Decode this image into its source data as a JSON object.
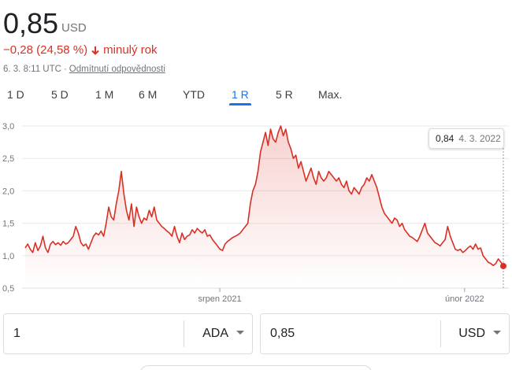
{
  "header": {
    "price": "0,85",
    "currency": "USD",
    "change_text": "−0,28 (24,58 %)",
    "change_period": "minulý rok",
    "timestamp": "6. 3. 8:11 UTC",
    "separator": "·",
    "disclaimer_link": "Odmítnutí odpovědnosti"
  },
  "tabs": [
    {
      "label": "1 D",
      "active": false
    },
    {
      "label": "5 D",
      "active": false
    },
    {
      "label": "1 M",
      "active": false
    },
    {
      "label": "6 M",
      "active": false
    },
    {
      "label": "YTD",
      "active": false
    },
    {
      "label": "1 R",
      "active": true
    },
    {
      "label": "5 R",
      "active": false
    },
    {
      "label": "Max.",
      "active": false
    }
  ],
  "tooltip": {
    "value": "0,84",
    "date": "4. 3. 2022"
  },
  "converter": {
    "from_value": "1",
    "from_unit": "ADA",
    "to_value": "0,85",
    "to_unit": "USD"
  },
  "colors": {
    "line": "#d93025",
    "accent": "#1a73e8",
    "grid": "#e8eaed",
    "axis_text": "#70757a"
  },
  "chart_data": {
    "type": "area",
    "y_ticks": [
      "3,0",
      "2,5",
      "2,0",
      "1,5",
      "1,0",
      "0,5"
    ],
    "y_tick_values": [
      3.0,
      2.5,
      2.0,
      1.5,
      1.0,
      0.5
    ],
    "ylim": [
      0.5,
      3.0
    ],
    "x_ticks": [
      {
        "label": "srpen 2021",
        "t": 0.407
      },
      {
        "label": "únor 2022",
        "t": 0.919
      }
    ],
    "grid": true,
    "series": [
      {
        "values": [
          1.12,
          1.18,
          1.1,
          1.05,
          1.2,
          1.08,
          1.15,
          1.3,
          1.12,
          1.05,
          1.18,
          1.22,
          1.17,
          1.2,
          1.16,
          1.22,
          1.18,
          1.2,
          1.25,
          1.3,
          1.45,
          1.35,
          1.2,
          1.15,
          1.18,
          1.1,
          1.2,
          1.3,
          1.35,
          1.32,
          1.38,
          1.3,
          1.5,
          1.75,
          1.6,
          1.55,
          1.8,
          2.0,
          2.3,
          1.95,
          1.7,
          1.55,
          1.8,
          1.45,
          1.75,
          1.6,
          1.5,
          1.58,
          1.55,
          1.7,
          1.6,
          1.75,
          1.55,
          1.5,
          1.45,
          1.42,
          1.38,
          1.35,
          1.3,
          1.45,
          1.3,
          1.2,
          1.35,
          1.25,
          1.3,
          1.32,
          1.4,
          1.35,
          1.42,
          1.38,
          1.35,
          1.4,
          1.3,
          1.32,
          1.25,
          1.2,
          1.15,
          1.1,
          1.08,
          1.18,
          1.22,
          1.25,
          1.28,
          1.3,
          1.32,
          1.35,
          1.4,
          1.45,
          1.5,
          1.8,
          2.0,
          2.1,
          2.3,
          2.6,
          2.75,
          2.9,
          2.7,
          2.95,
          2.8,
          2.75,
          2.9,
          3.0,
          2.85,
          2.95,
          2.75,
          2.65,
          2.5,
          2.55,
          2.35,
          2.45,
          2.3,
          2.15,
          2.25,
          2.35,
          2.2,
          2.1,
          2.3,
          2.2,
          2.15,
          2.2,
          2.3,
          2.25,
          2.2,
          2.15,
          2.2,
          2.1,
          2.05,
          2.15,
          2.0,
          1.95,
          2.05,
          2.0,
          1.95,
          2.05,
          2.1,
          2.2,
          2.15,
          2.25,
          2.15,
          2.05,
          1.9,
          1.75,
          1.65,
          1.6,
          1.55,
          1.5,
          1.58,
          1.55,
          1.45,
          1.5,
          1.4,
          1.35,
          1.3,
          1.28,
          1.25,
          1.22,
          1.3,
          1.4,
          1.5,
          1.35,
          1.3,
          1.25,
          1.2,
          1.18,
          1.15,
          1.2,
          1.25,
          1.45,
          1.3,
          1.2,
          1.1,
          1.08,
          1.1,
          1.05,
          1.08,
          1.12,
          1.15,
          1.1,
          1.18,
          1.1,
          1.12,
          1.0,
          0.95,
          0.9,
          0.88,
          0.85,
          0.88,
          0.95,
          0.9,
          0.84
        ]
      }
    ]
  }
}
